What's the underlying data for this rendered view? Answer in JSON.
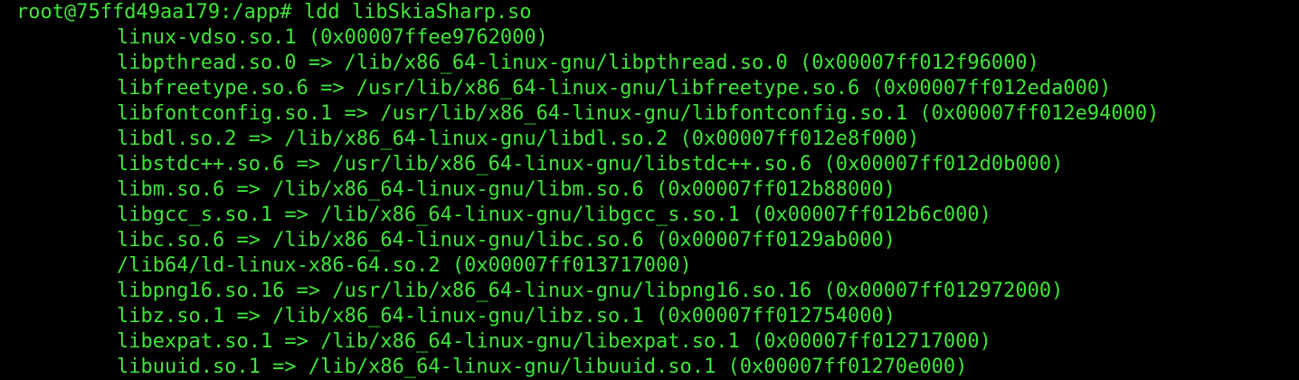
{
  "terminal": {
    "prompt": "root@75ffd49aa179:/app#",
    "command": "ldd libSkiaSharp.so",
    "text_color": "#3fe53a",
    "background": "#000000",
    "lines": [
      "linux-vdso.so.1 (0x00007ffee9762000)",
      "libpthread.so.0 => /lib/x86_64-linux-gnu/libpthread.so.0 (0x00007ff012f96000)",
      "libfreetype.so.6 => /usr/lib/x86_64-linux-gnu/libfreetype.so.6 (0x00007ff012eda000)",
      "libfontconfig.so.1 => /usr/lib/x86_64-linux-gnu/libfontconfig.so.1 (0x00007ff012e94000)",
      "libdl.so.2 => /lib/x86_64-linux-gnu/libdl.so.2 (0x00007ff012e8f000)",
      "libstdc++.so.6 => /usr/lib/x86_64-linux-gnu/libstdc++.so.6 (0x00007ff012d0b000)",
      "libm.so.6 => /lib/x86_64-linux-gnu/libm.so.6 (0x00007ff012b88000)",
      "libgcc_s.so.1 => /lib/x86_64-linux-gnu/libgcc_s.so.1 (0x00007ff012b6c000)",
      "libc.so.6 => /lib/x86_64-linux-gnu/libc.so.6 (0x00007ff0129ab000)",
      "/lib64/ld-linux-x86-64.so.2 (0x00007ff013717000)",
      "libpng16.so.16 => /usr/lib/x86_64-linux-gnu/libpng16.so.16 (0x00007ff012972000)",
      "libz.so.1 => /lib/x86_64-linux-gnu/libz.so.1 (0x00007ff012754000)",
      "libexpat.so.1 => /lib/x86_64-linux-gnu/libexpat.so.1 (0x00007ff012717000)",
      "libuuid.so.1 => /lib/x86_64-linux-gnu/libuuid.so.1 (0x00007ff01270e000)"
    ]
  }
}
